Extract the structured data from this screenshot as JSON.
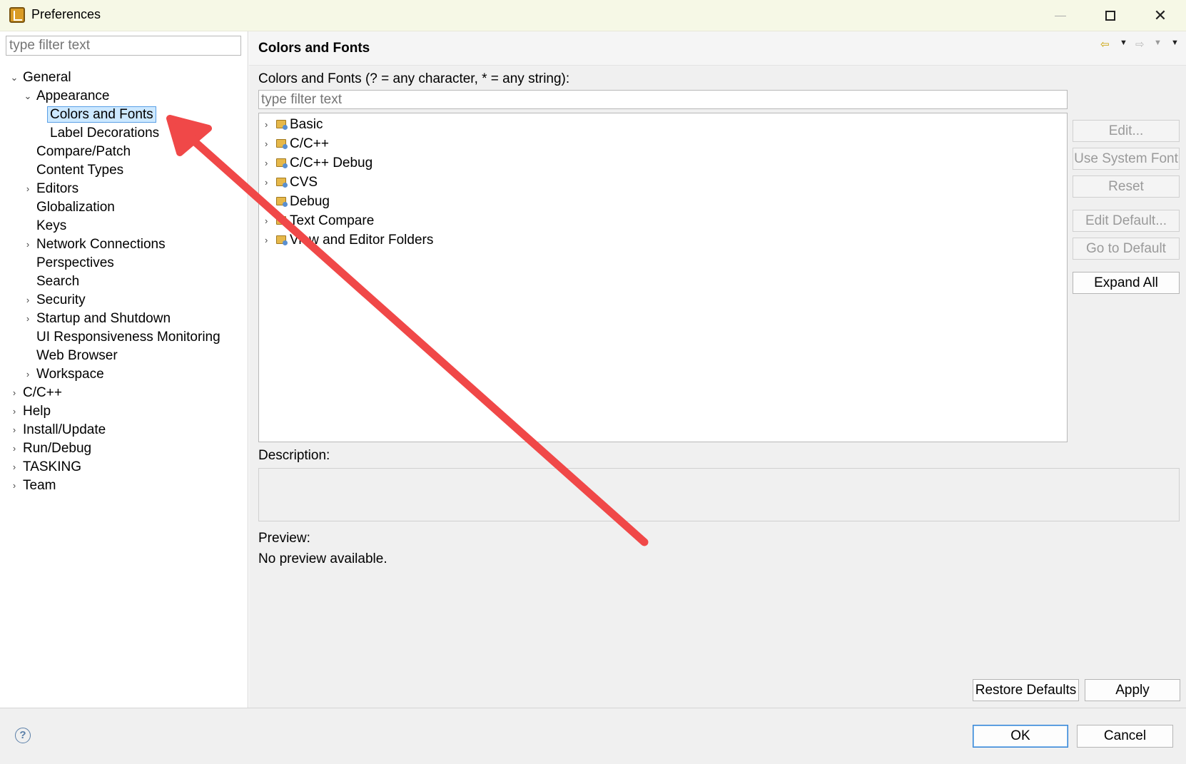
{
  "window": {
    "title": "Preferences",
    "minimize_label": "—",
    "close_label": "✕"
  },
  "left": {
    "filter_placeholder": "type filter text",
    "tree": [
      {
        "label": "General",
        "twisty": "⌄"
      },
      {
        "label": "Appearance",
        "twisty": "⌄"
      },
      {
        "label": "Colors and Fonts",
        "twisty": ""
      },
      {
        "label": "Label Decorations",
        "twisty": ""
      },
      {
        "label": "Compare/Patch",
        "twisty": ""
      },
      {
        "label": "Content Types",
        "twisty": ""
      },
      {
        "label": "Editors",
        "twisty": "›"
      },
      {
        "label": "Globalization",
        "twisty": ""
      },
      {
        "label": "Keys",
        "twisty": ""
      },
      {
        "label": "Network Connections",
        "twisty": "›"
      },
      {
        "label": "Perspectives",
        "twisty": ""
      },
      {
        "label": "Search",
        "twisty": ""
      },
      {
        "label": "Security",
        "twisty": "›"
      },
      {
        "label": "Startup and Shutdown",
        "twisty": "›"
      },
      {
        "label": "UI Responsiveness Monitoring",
        "twisty": ""
      },
      {
        "label": "Web Browser",
        "twisty": ""
      },
      {
        "label": "Workspace",
        "twisty": "›"
      },
      {
        "label": "C/C++",
        "twisty": "›"
      },
      {
        "label": "Help",
        "twisty": "›"
      },
      {
        "label": "Install/Update",
        "twisty": "›"
      },
      {
        "label": "Run/Debug",
        "twisty": "›"
      },
      {
        "label": "TASKING",
        "twisty": "›"
      },
      {
        "label": "Team",
        "twisty": "›"
      }
    ]
  },
  "right": {
    "title": "Colors and Fonts",
    "nav": {
      "back_icon": "⇦",
      "forward_icon": "⇨",
      "dropdown_icon": "▼"
    },
    "filter_label": "Colors and Fonts (? = any character, * = any string):",
    "filter_placeholder": "type filter text",
    "categories": [
      {
        "label": "Basic",
        "twisty": "›"
      },
      {
        "label": "C/C++",
        "twisty": "›"
      },
      {
        "label": "C/C++ Debug",
        "twisty": "›"
      },
      {
        "label": "CVS",
        "twisty": "›"
      },
      {
        "label": "Debug",
        "twisty": "›"
      },
      {
        "label": "Text Compare",
        "twisty": "›"
      },
      {
        "label": "View and Editor Folders",
        "twisty": "›"
      }
    ],
    "buttons": {
      "edit": "Edit...",
      "use_system_font": "Use System Font",
      "reset": "Reset",
      "edit_default": "Edit Default...",
      "go_to_default": "Go to Default",
      "expand_all": "Expand All"
    },
    "description_label": "Description:",
    "preview_label": "Preview:",
    "preview_text": "No preview available.",
    "restore_defaults": "Restore Defaults",
    "apply": "Apply"
  },
  "footer": {
    "help_icon": "?",
    "ok": "OK",
    "cancel": "Cancel"
  },
  "colors": {
    "selection": "#cce8ff",
    "selection_border": "#5aa0e6",
    "annotation_arrow": "#f04848",
    "default_button_border": "#2f7fd2"
  }
}
